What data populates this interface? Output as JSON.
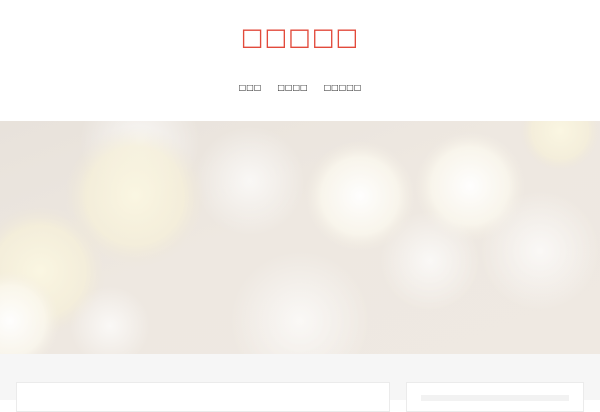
{
  "header": {
    "site_title": "□□□□□"
  },
  "nav": {
    "items": [
      {
        "label": "□□□",
        "key": "home"
      },
      {
        "label": "□□□□",
        "key": "about"
      },
      {
        "label": "□□□□□",
        "key": "contact"
      }
    ]
  },
  "colors": {
    "title": "#e24a3b",
    "nav_text": "#222222",
    "hero_base": "#ece6df",
    "content_bg": "#f6f6f6",
    "card_bg": "#ffffff"
  }
}
